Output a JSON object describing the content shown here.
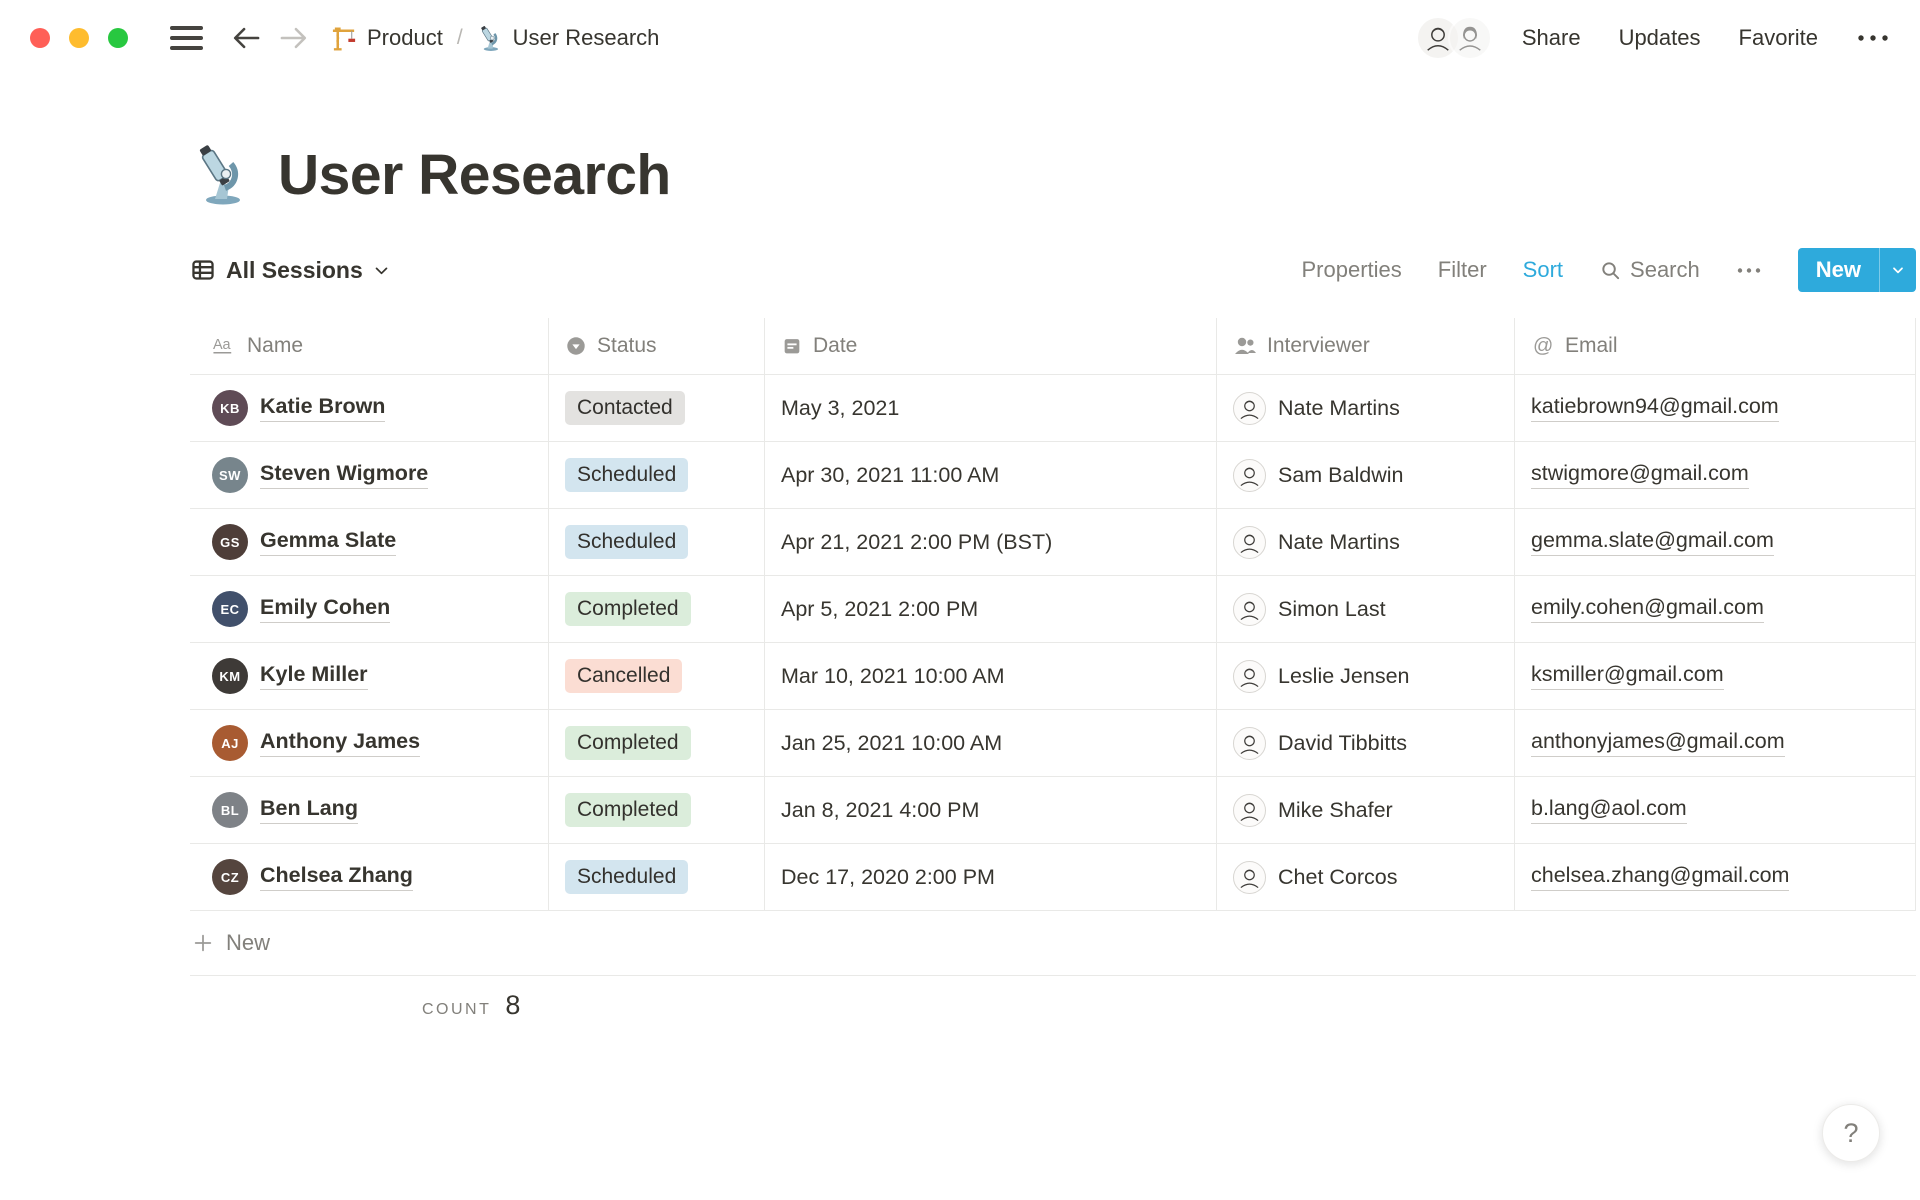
{
  "window": {
    "breadcrumb": {
      "items": [
        {
          "icon": "crane-icon",
          "label": "Product"
        },
        {
          "icon": "microscope-icon",
          "label": "User Research"
        }
      ],
      "separator": "/"
    },
    "actions": {
      "share": "Share",
      "updates": "Updates",
      "favorite": "Favorite"
    }
  },
  "page": {
    "title": "User Research",
    "icon": "microscope-icon"
  },
  "toolbar": {
    "view_label": "All Sessions",
    "properties_label": "Properties",
    "filter_label": "Filter",
    "sort_label": "Sort",
    "search_label": "Search",
    "new_label": "New",
    "accent_color": "#2EAADC",
    "sort_active_color": "#2EAADC"
  },
  "table": {
    "columns": [
      {
        "key": "name",
        "label": "Name",
        "icon": "text-property-icon"
      },
      {
        "key": "status",
        "label": "Status",
        "icon": "select-property-icon"
      },
      {
        "key": "date",
        "label": "Date",
        "icon": "calendar-icon"
      },
      {
        "key": "interviewer",
        "label": "Interviewer",
        "icon": "person-property-icon"
      },
      {
        "key": "email",
        "label": "Email",
        "icon": "at-icon"
      }
    ],
    "status_colors": {
      "Contacted": "#E3E2E0",
      "Scheduled": "#D3E5EF",
      "Completed": "#DBEDDB",
      "Cancelled": "#FBDDD3"
    },
    "rows": [
      {
        "name": "Katie Brown",
        "avatar_color": "#5F4B56",
        "status": "Contacted",
        "date": "May 3, 2021",
        "interviewer": "Nate Martins",
        "email": "katiebrown94@gmail.com"
      },
      {
        "name": "Steven Wigmore",
        "avatar_color": "#77858C",
        "status": "Scheduled",
        "date": "Apr 30, 2021 11:00 AM",
        "interviewer": "Sam Baldwin",
        "email": "stwigmore@gmail.com"
      },
      {
        "name": "Gemma Slate",
        "avatar_color": "#4E3E39",
        "status": "Scheduled",
        "date": "Apr 21, 2021 2:00 PM (BST)",
        "interviewer": "Nate Martins",
        "email": "gemma.slate@gmail.com"
      },
      {
        "name": "Emily Cohen",
        "avatar_color": "#41506B",
        "status": "Completed",
        "date": "Apr 5, 2021 2:00 PM",
        "interviewer": "Simon Last",
        "email": "emily.cohen@gmail.com"
      },
      {
        "name": "Kyle Miller",
        "avatar_color": "#3E3A37",
        "status": "Cancelled",
        "date": "Mar 10, 2021 10:00 AM",
        "interviewer": "Leslie Jensen",
        "email": "ksmiller@gmail.com"
      },
      {
        "name": "Anthony James",
        "avatar_color": "#A85B32",
        "status": "Completed",
        "date": "Jan 25, 2021 10:00 AM",
        "interviewer": "David Tibbitts",
        "email": "anthonyjames@gmail.com"
      },
      {
        "name": "Ben Lang",
        "avatar_color": "#7E8287",
        "status": "Completed",
        "date": "Jan 8, 2021 4:00 PM",
        "interviewer": "Mike Shafer",
        "email": "b.lang@aol.com"
      },
      {
        "name": "Chelsea Zhang",
        "avatar_color": "#55453E",
        "status": "Scheduled",
        "date": "Dec 17, 2020 2:00 PM",
        "interviewer": "Chet Corcos",
        "email": "chelsea.zhang@gmail.com"
      }
    ],
    "new_row_label": "New",
    "footer": {
      "count_label": "COUNT",
      "count_value": "8"
    }
  },
  "help": {
    "label": "?"
  }
}
